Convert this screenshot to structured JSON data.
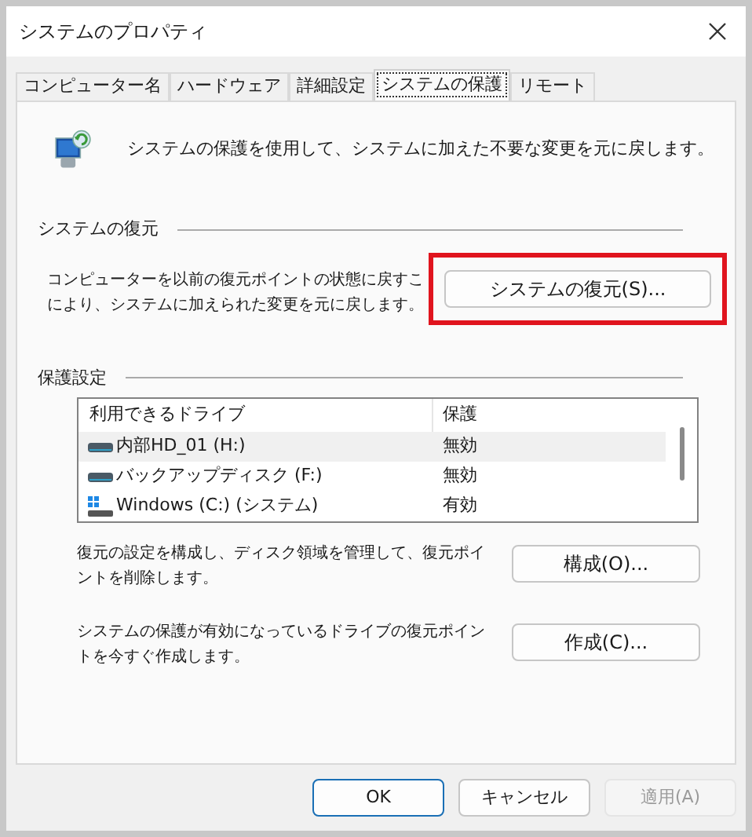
{
  "window": {
    "title": "システムのプロパティ"
  },
  "tabs": [
    {
      "label": "コンピューター名",
      "selected": false
    },
    {
      "label": "ハードウェア",
      "selected": false
    },
    {
      "label": "詳細設定",
      "selected": false
    },
    {
      "label": "システムの保護",
      "selected": true
    },
    {
      "label": "リモート",
      "selected": false
    }
  ],
  "intro": "システムの保護を使用して、システムに加えた不要な変更を元に戻します。",
  "restore": {
    "heading": "システムの復元",
    "description_lines": [
      "コンピューターを以前の復元ポイントの状態に戻すこ",
      "により、システムに加えられた変更を元に戻します。"
    ],
    "button": "システムの復元(S)...",
    "highlighted": true
  },
  "protection": {
    "heading": "保護設定",
    "columns": [
      "利用できるドライブ",
      "保護"
    ],
    "rows": [
      {
        "kind": "drive",
        "name": "内部HD_01 (H:)",
        "status": "無効",
        "selected": true
      },
      {
        "kind": "drive",
        "name": "バックアップディスク (F:)",
        "status": "無効",
        "selected": false
      },
      {
        "kind": "system",
        "name": "Windows (C:) (システム)",
        "status": "有効",
        "selected": false
      }
    ],
    "actions": [
      {
        "description": "復元の設定を構成し、ディスク領域を管理して、復元ポイントを削除します。",
        "button": "構成(O)..."
      },
      {
        "description": "システムの保護が有効になっているドライブの復元ポイントを今すぐ作成します。",
        "button": "作成(C)..."
      }
    ]
  },
  "buttons": [
    {
      "label": "OK",
      "kind": "default",
      "disabled": false
    },
    {
      "label": "キャンセル",
      "kind": "normal",
      "disabled": false
    },
    {
      "label": "適用(A)",
      "kind": "normal",
      "disabled": true
    }
  ]
}
